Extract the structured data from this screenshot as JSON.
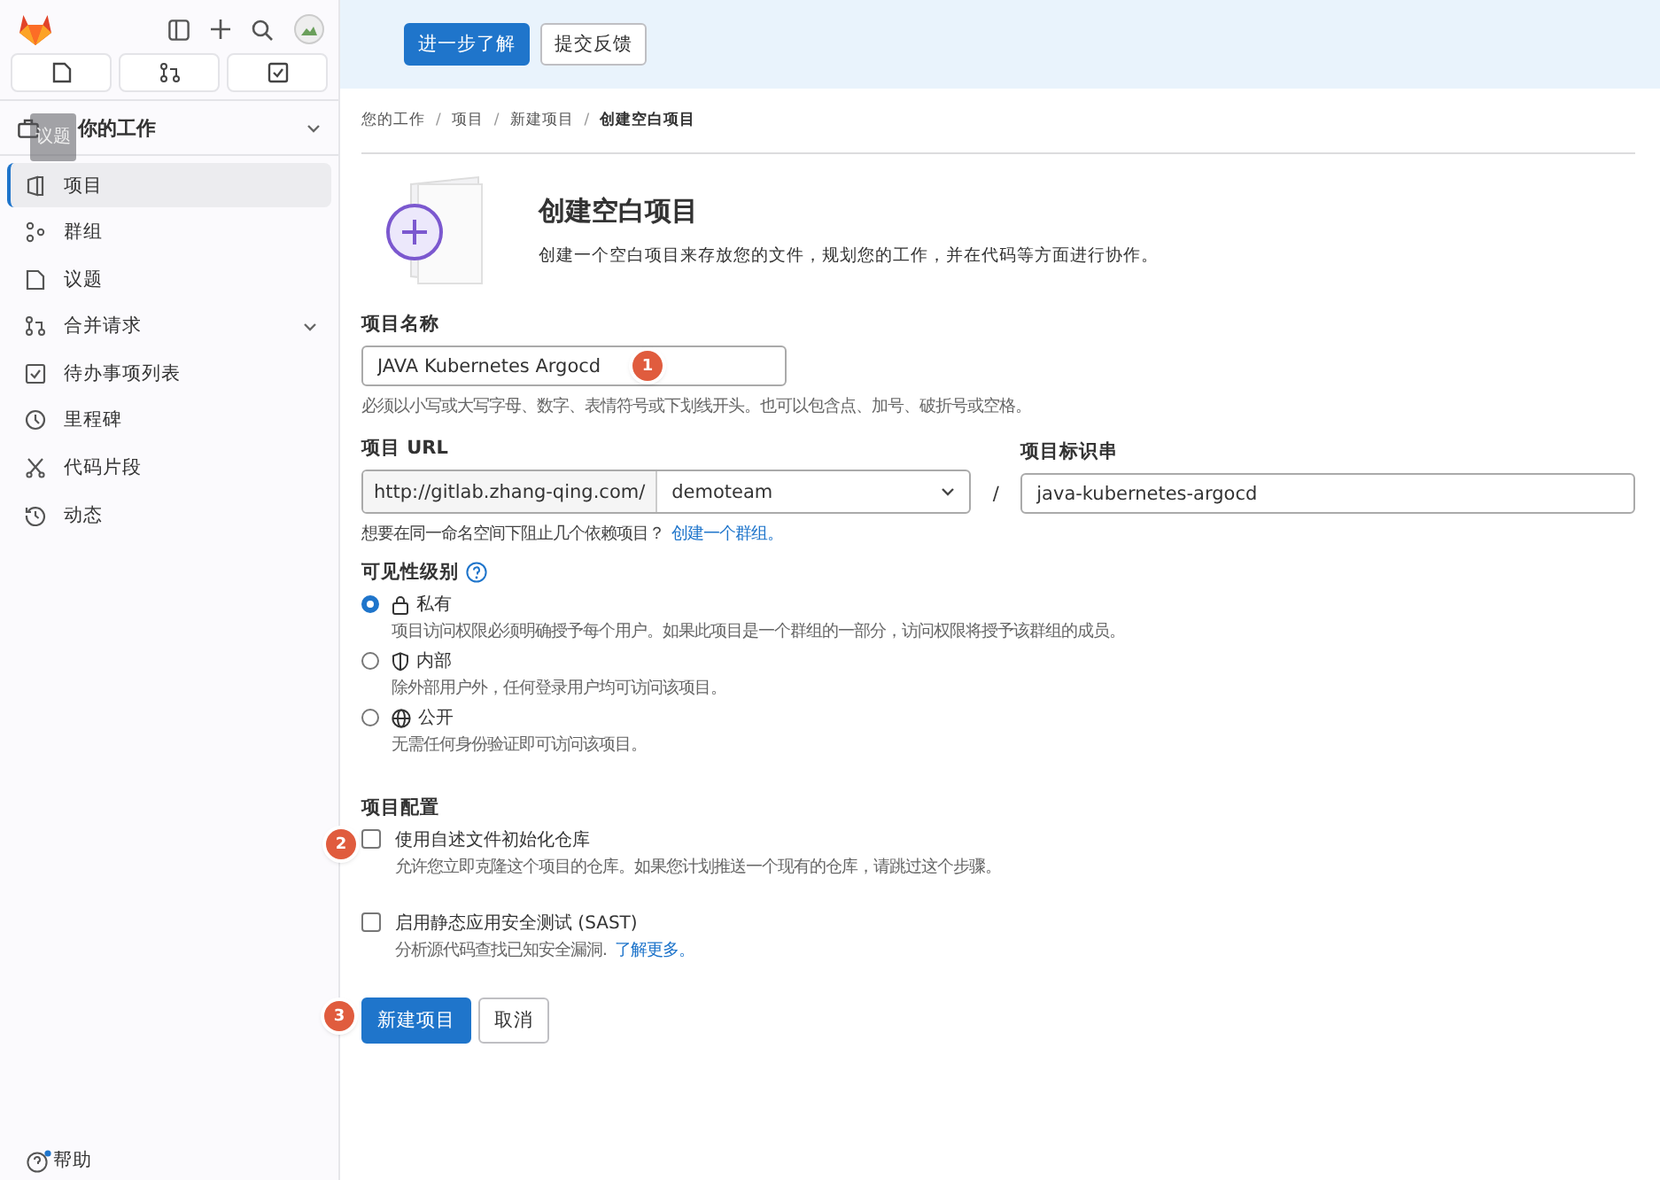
{
  "sidebar": {
    "top_tabs": [
      {
        "selected": false
      },
      {
        "selected": false
      },
      {
        "selected": false
      }
    ],
    "tooltip": "议题",
    "section": {
      "label": "你的工作",
      "expanded": true
    },
    "items": [
      {
        "label": "项目",
        "selected": true,
        "expandable": false
      },
      {
        "label": "群组",
        "selected": false,
        "expandable": false
      },
      {
        "label": "议题",
        "selected": false,
        "expandable": false
      },
      {
        "label": "合并请求",
        "selected": false,
        "expandable": true
      },
      {
        "label": "待办事项列表",
        "selected": false,
        "expandable": false
      },
      {
        "label": "里程碑",
        "selected": false,
        "expandable": false
      },
      {
        "label": "代码片段",
        "selected": false,
        "expandable": false
      },
      {
        "label": "动态",
        "selected": false,
        "expandable": false
      }
    ],
    "help": "帮助"
  },
  "banner": {
    "buttons": [
      {
        "label": "进一步了解",
        "kind": "primary"
      },
      {
        "label": "提交反馈",
        "kind": "default"
      }
    ]
  },
  "breadcrumbs": {
    "separator": "/",
    "items": [
      "您的工作",
      "项目",
      "新建项目",
      "创建空白项目"
    ]
  },
  "header": {
    "title": "创建空白项目",
    "description": "创建一个空白项目来存放您的文件，规划您的工作，并在代码等方面进行协作。"
  },
  "project_name": {
    "label": "项目名称",
    "value": "JAVA Kubernetes Argocd",
    "callout": "1",
    "hint": "必须以小写或大写字母、数字、表情符号或下划线开头。也可以包含点、加号、破折号或空格。"
  },
  "project_url": {
    "label": "项目 URL",
    "prefix": "http://gitlab.zhang-qing.com/",
    "namespace": "demoteam",
    "separator": "/",
    "hint": "想要在同一命名空间下阻止几个依赖项目？",
    "hint_link": "创建一个群组。"
  },
  "project_slug": {
    "label": "项目标识串",
    "value": "java-kubernetes-argocd"
  },
  "visibility": {
    "label": "可见性级别",
    "options": [
      {
        "label": "私有",
        "description": "项目访问权限必须明确授予每个用户。如果此项目是一个群组的一部分，访问权限将授予该群组的成员。",
        "selected": true
      },
      {
        "label": "内部",
        "description": "除外部用户外，任何登录用户均可访问该项目。",
        "selected": false
      },
      {
        "label": "公开",
        "description": "无需任何身份验证即可访问该项目。",
        "selected": false
      }
    ]
  },
  "configuration": {
    "label": "项目配置",
    "options": [
      {
        "label": "使用自述文件初始化仓库",
        "description": "允许您立即克隆这个项目的仓库。如果您计划推送一个现有的仓库，请跳过这个步骤。",
        "checked": false,
        "callout": "2"
      },
      {
        "label": "启用静态应用安全测试 (SAST)",
        "description": "分析源代码查找已知安全漏洞.",
        "link": "了解更多。",
        "checked": false
      }
    ]
  },
  "actions": {
    "callout": "3",
    "buttons": [
      {
        "label": "新建项目",
        "kind": "primary"
      },
      {
        "label": "取消",
        "kind": "default"
      }
    ]
  }
}
